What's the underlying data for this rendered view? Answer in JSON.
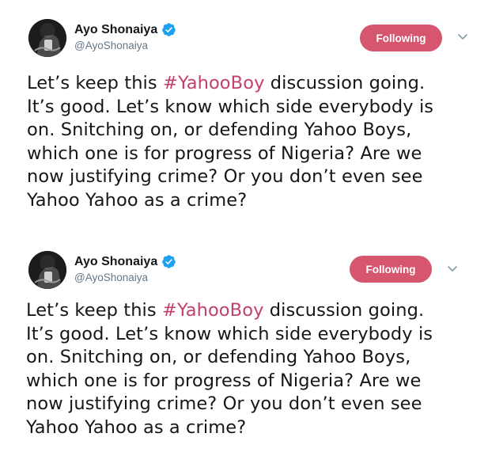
{
  "tweets": [
    {
      "author": {
        "display_name": "Ayo Shonaiya",
        "handle": "@AyoShonaiya",
        "verified": true
      },
      "follow_button_label": "Following",
      "text": {
        "lines": [
          [
            "Let’s keep this ",
            "#YahooBoy",
            " discussion going."
          ],
          [
            "It’s good. Let’s know which side everybody is"
          ],
          [
            "on. Snitching on, or defending Yahoo Boys,"
          ],
          [
            "which one is for progress of Nigeria? Are we"
          ],
          [
            "now justifying crime? Or you don’t even see"
          ],
          [
            "Yahoo Yahoo as a crime?"
          ]
        ],
        "hashtag": "#YahooBoy"
      }
    },
    {
      "author": {
        "display_name": "Ayo Shonaiya",
        "handle": "@AyoShonaiya",
        "verified": true
      },
      "follow_button_label": "Following",
      "text": {
        "lines": [
          [
            "Let’s keep this ",
            "#YahooBoy",
            " discussion going."
          ],
          [
            "It’s good. Let’s know which side everybody is"
          ],
          [
            "on. Snitching on, or defending Yahoo Boys,"
          ],
          [
            "which one is for progress of Nigeria? Are we"
          ],
          [
            "now justifying crime? Or you don’t even see"
          ],
          [
            "Yahoo Yahoo as a crime?"
          ]
        ],
        "hashtag": "#YahooBoy"
      }
    }
  ],
  "colors": {
    "following_button": "#d6566f",
    "hashtag": "#c2416b",
    "verified_badge": "#1da1f2",
    "handle": "#657786"
  },
  "icons": {
    "verified": "verified-badge-icon",
    "caret": "chevron-down-icon",
    "avatar": "user-avatar"
  }
}
